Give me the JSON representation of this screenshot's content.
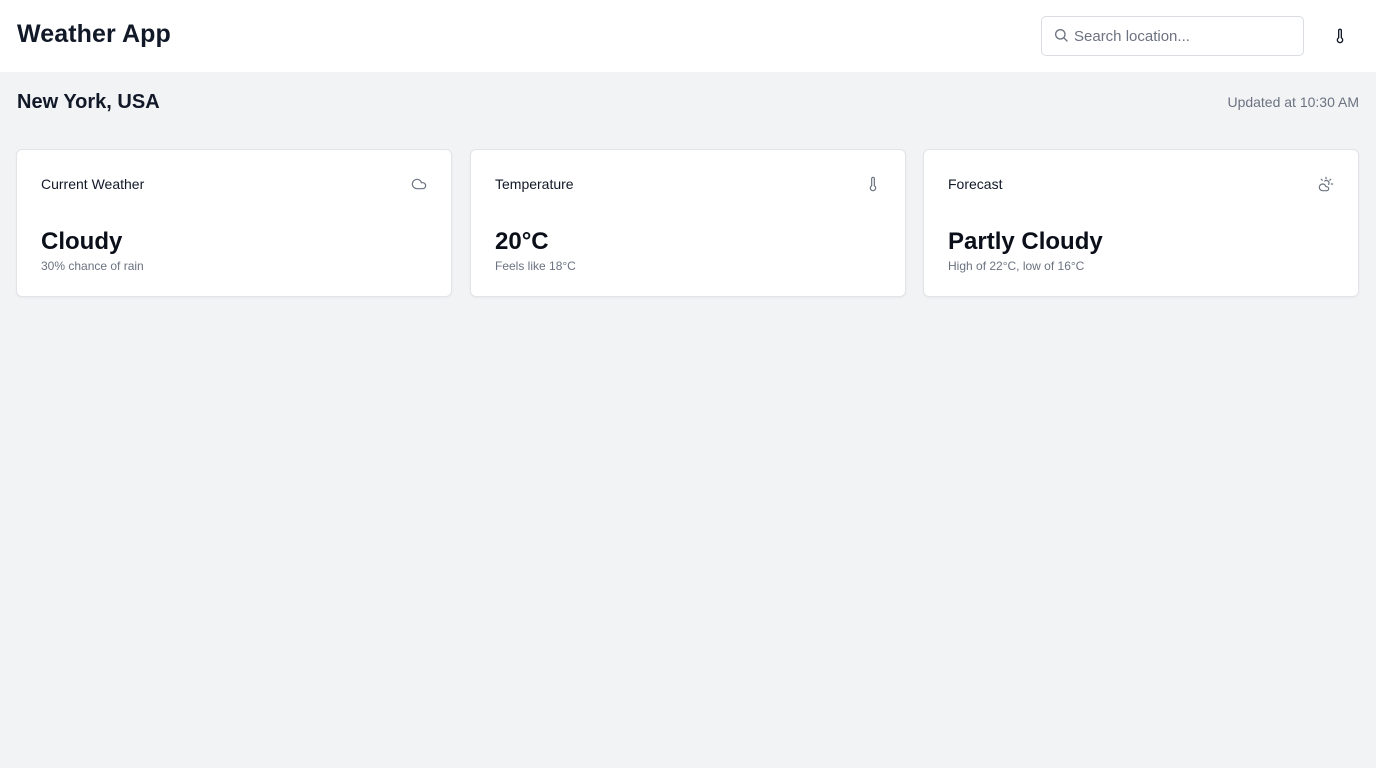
{
  "header": {
    "title": "Weather App",
    "search_placeholder": "Search location...",
    "search_value": "",
    "unit_toggle_icon": "thermometer-icon"
  },
  "location": {
    "name": "New York, USA",
    "updated": "Updated at 10:30 AM"
  },
  "cards": [
    {
      "title": "Current Weather",
      "icon": "cloud-icon",
      "value": "Cloudy",
      "subtext": "30% chance of rain"
    },
    {
      "title": "Temperature",
      "icon": "thermometer-icon",
      "value": "20°C",
      "subtext": "Feels like 18°C"
    },
    {
      "title": "Forecast",
      "icon": "cloud-sun-icon",
      "value": "Partly Cloudy",
      "subtext": "High of 22°C, low of 16°C"
    }
  ],
  "colors": {
    "background": "#f2f3f5",
    "surface": "#ffffff",
    "text_primary": "#111827",
    "text_muted": "#6b7280",
    "border": "#e2e4e8"
  }
}
